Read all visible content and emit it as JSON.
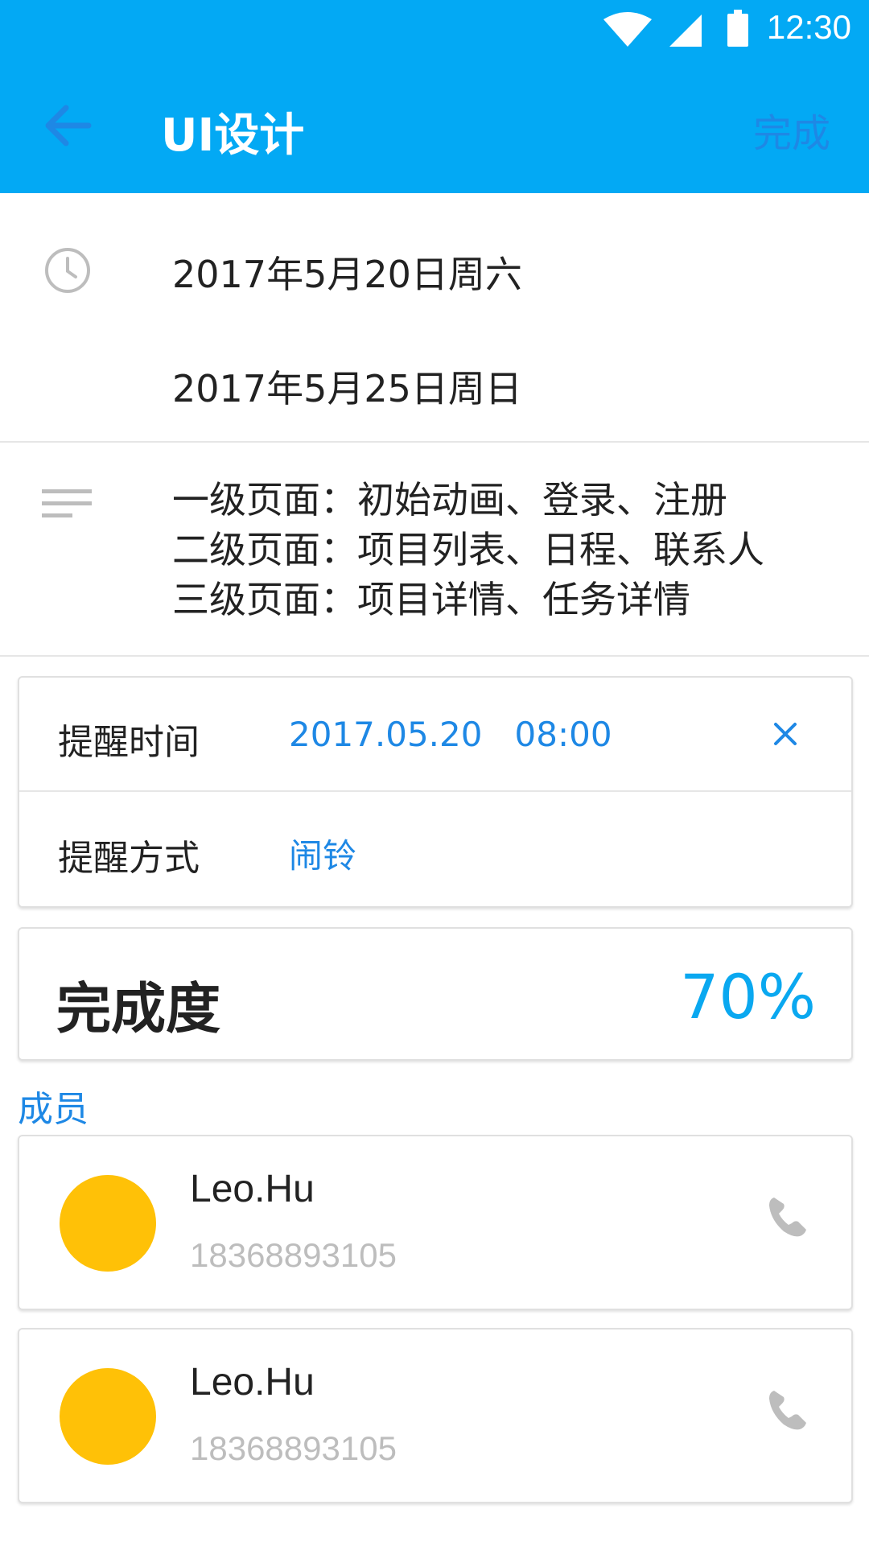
{
  "status_bar": {
    "time": "12:30",
    "icons": [
      "wifi-icon",
      "cell-signal-icon",
      "battery-icon"
    ]
  },
  "app_bar": {
    "title": "UI设计",
    "back_icon": "arrow-left-icon",
    "done_label": "完成"
  },
  "dates": {
    "icon": "clock-icon",
    "start": "2017年5月20日周六",
    "end": "2017年5月25日周日"
  },
  "notes": {
    "icon": "notes-icon",
    "lines": [
      "一级页面：初始动画、登录、注册",
      "二级页面：项目列表、日程、联系人",
      "三级页面：项目详情、任务详情"
    ]
  },
  "reminder": {
    "time_label": "提醒时间",
    "time_value": "2017.05.20   08:00",
    "clear_icon": "close-icon",
    "method_label": "提醒方式",
    "method_value": "闹铃"
  },
  "progress": {
    "label": "完成度",
    "value": "70%"
  },
  "members": {
    "header": "成员",
    "items": [
      {
        "name": "Leo.Hu",
        "phone": "18368893105",
        "icon": "phone-icon"
      },
      {
        "name": "Leo.Hu",
        "phone": "18368893105",
        "icon": "phone-icon"
      }
    ]
  },
  "colors": {
    "primary": "#03A9F4",
    "accent_text": "#1E88E5",
    "avatar": "#FFC107",
    "secondary_text": "#BDBDBD"
  }
}
